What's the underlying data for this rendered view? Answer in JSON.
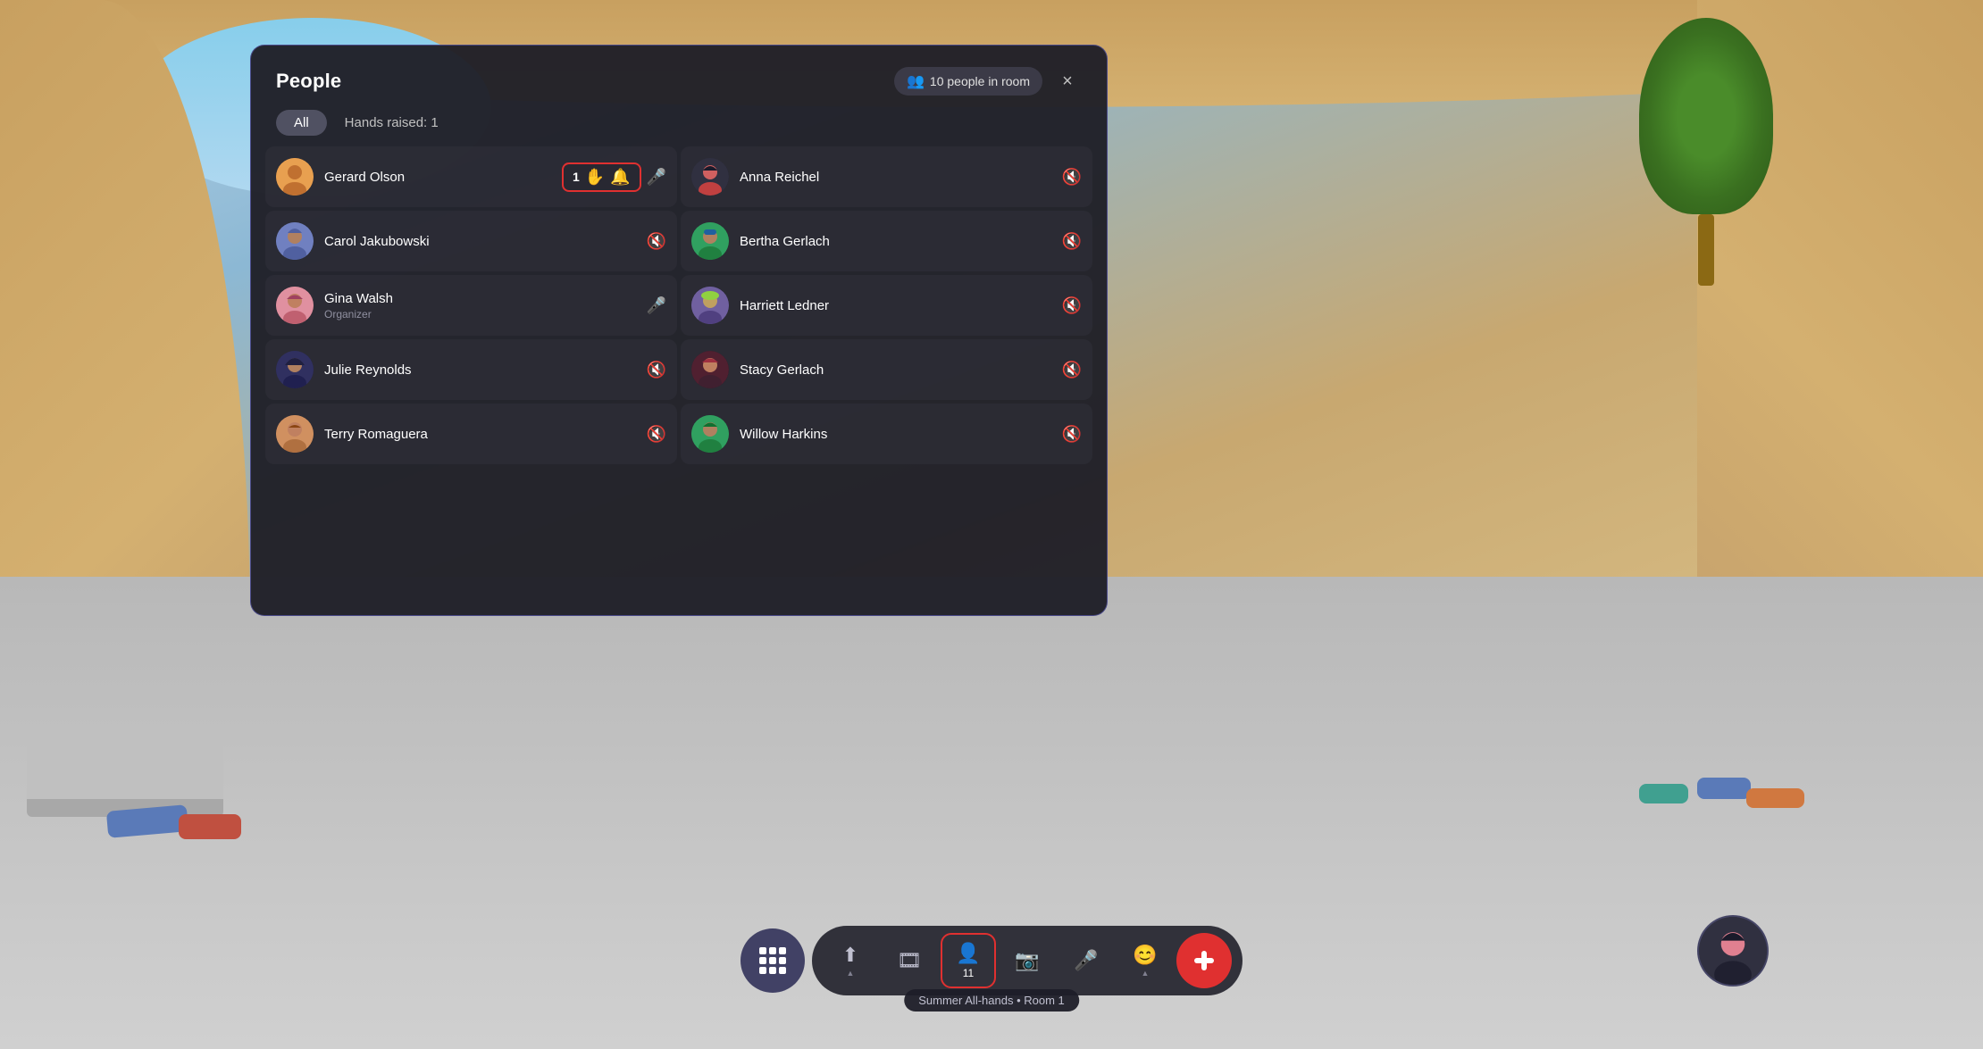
{
  "background": {
    "colors": {
      "sky": "#87CEEB",
      "wall": "#c8a060",
      "floor": "#c8c8c8"
    }
  },
  "panel": {
    "title": "People",
    "close_label": "×",
    "people_count_label": "10 people in room",
    "tabs": [
      {
        "id": "all",
        "label": "All",
        "active": true
      },
      {
        "id": "hands",
        "label": "Hands raised: 1",
        "active": false
      }
    ],
    "people": [
      {
        "id": "gerard",
        "name": "Gerard Olson",
        "role": "",
        "avatar_bg": "gerard",
        "has_raised_hand": true,
        "hand_count": "1",
        "mic": "active",
        "col": 0
      },
      {
        "id": "anna",
        "name": "Anna Reichel",
        "role": "",
        "avatar_bg": "anna",
        "has_raised_hand": false,
        "mic": "muted",
        "col": 1
      },
      {
        "id": "carol",
        "name": "Carol Jakubowski",
        "role": "",
        "avatar_bg": "carol",
        "has_raised_hand": false,
        "mic": "muted",
        "col": 0
      },
      {
        "id": "bertha",
        "name": "Bertha Gerlach",
        "role": "",
        "avatar_bg": "bertha",
        "has_raised_hand": false,
        "mic": "muted",
        "col": 1
      },
      {
        "id": "gina",
        "name": "Gina Walsh",
        "role": "Organizer",
        "avatar_bg": "gina",
        "has_raised_hand": false,
        "mic": "active",
        "col": 0
      },
      {
        "id": "harriett",
        "name": "Harriett Ledner",
        "role": "",
        "avatar_bg": "harriett",
        "has_raised_hand": false,
        "mic": "muted",
        "col": 1
      },
      {
        "id": "julie",
        "name": "Julie Reynolds",
        "role": "",
        "avatar_bg": "julie",
        "has_raised_hand": false,
        "mic": "muted",
        "col": 0
      },
      {
        "id": "stacy",
        "name": "Stacy Gerlach",
        "role": "",
        "avatar_bg": "stacy",
        "has_raised_hand": false,
        "mic": "muted",
        "col": 1
      },
      {
        "id": "terry",
        "name": "Terry Romaguera",
        "role": "",
        "avatar_bg": "terry",
        "has_raised_hand": false,
        "mic": "muted",
        "col": 0
      },
      {
        "id": "willow",
        "name": "Willow Harkins",
        "role": "",
        "avatar_bg": "willow",
        "has_raised_hand": false,
        "mic": "muted",
        "col": 1
      }
    ]
  },
  "toolbar": {
    "share_label": "↑",
    "film_label": "🎞",
    "people_label": "👤",
    "people_count": "11",
    "camera_label": "📷",
    "mic_label": "🎤",
    "reaction_label": "😊",
    "leave_label": "⬛",
    "status_text": "Summer All-hands • Room 1"
  },
  "icons": {
    "apps": "⊞",
    "close": "×",
    "people": "👥",
    "mic_on": "🎤",
    "mic_off": "🎤",
    "bell": "🔔",
    "hand": "✋",
    "share": "⬆",
    "film": "🎬",
    "camera": "📷",
    "reaction": "😊",
    "leave": "📞"
  }
}
